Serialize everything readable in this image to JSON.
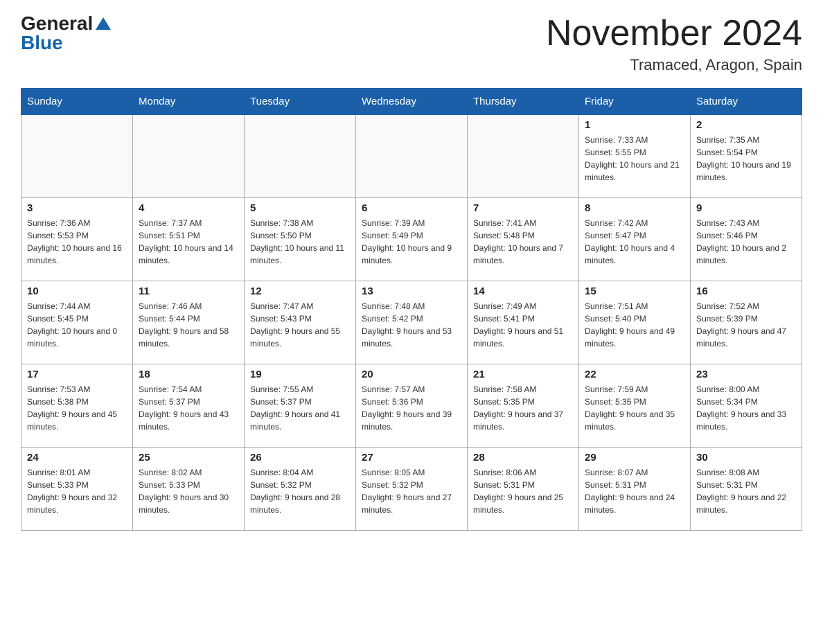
{
  "header": {
    "logo_general": "General",
    "logo_blue": "Blue",
    "title": "November 2024",
    "location": "Tramaced, Aragon, Spain"
  },
  "days_of_week": [
    "Sunday",
    "Monday",
    "Tuesday",
    "Wednesday",
    "Thursday",
    "Friday",
    "Saturday"
  ],
  "weeks": [
    [
      {
        "day": "",
        "info": ""
      },
      {
        "day": "",
        "info": ""
      },
      {
        "day": "",
        "info": ""
      },
      {
        "day": "",
        "info": ""
      },
      {
        "day": "",
        "info": ""
      },
      {
        "day": "1",
        "info": "Sunrise: 7:33 AM\nSunset: 5:55 PM\nDaylight: 10 hours and 21 minutes."
      },
      {
        "day": "2",
        "info": "Sunrise: 7:35 AM\nSunset: 5:54 PM\nDaylight: 10 hours and 19 minutes."
      }
    ],
    [
      {
        "day": "3",
        "info": "Sunrise: 7:36 AM\nSunset: 5:53 PM\nDaylight: 10 hours and 16 minutes."
      },
      {
        "day": "4",
        "info": "Sunrise: 7:37 AM\nSunset: 5:51 PM\nDaylight: 10 hours and 14 minutes."
      },
      {
        "day": "5",
        "info": "Sunrise: 7:38 AM\nSunset: 5:50 PM\nDaylight: 10 hours and 11 minutes."
      },
      {
        "day": "6",
        "info": "Sunrise: 7:39 AM\nSunset: 5:49 PM\nDaylight: 10 hours and 9 minutes."
      },
      {
        "day": "7",
        "info": "Sunrise: 7:41 AM\nSunset: 5:48 PM\nDaylight: 10 hours and 7 minutes."
      },
      {
        "day": "8",
        "info": "Sunrise: 7:42 AM\nSunset: 5:47 PM\nDaylight: 10 hours and 4 minutes."
      },
      {
        "day": "9",
        "info": "Sunrise: 7:43 AM\nSunset: 5:46 PM\nDaylight: 10 hours and 2 minutes."
      }
    ],
    [
      {
        "day": "10",
        "info": "Sunrise: 7:44 AM\nSunset: 5:45 PM\nDaylight: 10 hours and 0 minutes."
      },
      {
        "day": "11",
        "info": "Sunrise: 7:46 AM\nSunset: 5:44 PM\nDaylight: 9 hours and 58 minutes."
      },
      {
        "day": "12",
        "info": "Sunrise: 7:47 AM\nSunset: 5:43 PM\nDaylight: 9 hours and 55 minutes."
      },
      {
        "day": "13",
        "info": "Sunrise: 7:48 AM\nSunset: 5:42 PM\nDaylight: 9 hours and 53 minutes."
      },
      {
        "day": "14",
        "info": "Sunrise: 7:49 AM\nSunset: 5:41 PM\nDaylight: 9 hours and 51 minutes."
      },
      {
        "day": "15",
        "info": "Sunrise: 7:51 AM\nSunset: 5:40 PM\nDaylight: 9 hours and 49 minutes."
      },
      {
        "day": "16",
        "info": "Sunrise: 7:52 AM\nSunset: 5:39 PM\nDaylight: 9 hours and 47 minutes."
      }
    ],
    [
      {
        "day": "17",
        "info": "Sunrise: 7:53 AM\nSunset: 5:38 PM\nDaylight: 9 hours and 45 minutes."
      },
      {
        "day": "18",
        "info": "Sunrise: 7:54 AM\nSunset: 5:37 PM\nDaylight: 9 hours and 43 minutes."
      },
      {
        "day": "19",
        "info": "Sunrise: 7:55 AM\nSunset: 5:37 PM\nDaylight: 9 hours and 41 minutes."
      },
      {
        "day": "20",
        "info": "Sunrise: 7:57 AM\nSunset: 5:36 PM\nDaylight: 9 hours and 39 minutes."
      },
      {
        "day": "21",
        "info": "Sunrise: 7:58 AM\nSunset: 5:35 PM\nDaylight: 9 hours and 37 minutes."
      },
      {
        "day": "22",
        "info": "Sunrise: 7:59 AM\nSunset: 5:35 PM\nDaylight: 9 hours and 35 minutes."
      },
      {
        "day": "23",
        "info": "Sunrise: 8:00 AM\nSunset: 5:34 PM\nDaylight: 9 hours and 33 minutes."
      }
    ],
    [
      {
        "day": "24",
        "info": "Sunrise: 8:01 AM\nSunset: 5:33 PM\nDaylight: 9 hours and 32 minutes."
      },
      {
        "day": "25",
        "info": "Sunrise: 8:02 AM\nSunset: 5:33 PM\nDaylight: 9 hours and 30 minutes."
      },
      {
        "day": "26",
        "info": "Sunrise: 8:04 AM\nSunset: 5:32 PM\nDaylight: 9 hours and 28 minutes."
      },
      {
        "day": "27",
        "info": "Sunrise: 8:05 AM\nSunset: 5:32 PM\nDaylight: 9 hours and 27 minutes."
      },
      {
        "day": "28",
        "info": "Sunrise: 8:06 AM\nSunset: 5:31 PM\nDaylight: 9 hours and 25 minutes."
      },
      {
        "day": "29",
        "info": "Sunrise: 8:07 AM\nSunset: 5:31 PM\nDaylight: 9 hours and 24 minutes."
      },
      {
        "day": "30",
        "info": "Sunrise: 8:08 AM\nSunset: 5:31 PM\nDaylight: 9 hours and 22 minutes."
      }
    ]
  ]
}
